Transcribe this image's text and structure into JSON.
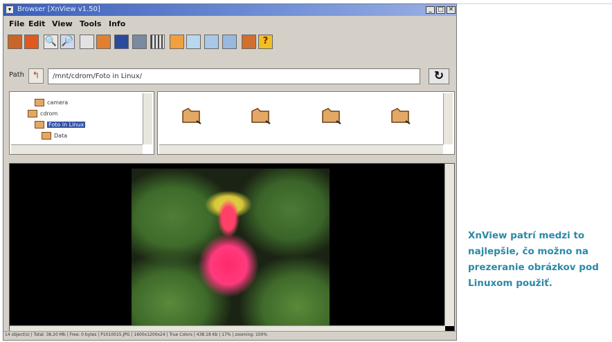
{
  "window": {
    "title": "Browser [XnView v1.50]",
    "controls": [
      "_",
      "□",
      "✕"
    ]
  },
  "menubar": {
    "items": [
      "File",
      "Edit",
      "View",
      "Tools",
      "Info"
    ]
  },
  "toolbar": {
    "icons": [
      "window-icon",
      "image-icon",
      "zoom-in-icon",
      "zoom-out-icon",
      "slideshow-icon",
      "capture-icon",
      "monitor-icon",
      "print-icon",
      "grid-icon",
      "thumbnail-icon",
      "view1-icon",
      "view2-icon",
      "view3-icon",
      "settings-icon",
      "help-icon"
    ]
  },
  "pathbar": {
    "label": "Path",
    "value": "/mnt/cdrom/Foto in Linux/",
    "refresh_glyph": "↻"
  },
  "tree": {
    "nodes": [
      "camera",
      "cdrom",
      "Foto in Linux",
      "Data"
    ]
  },
  "status": {
    "text": "14 object(s) | Total: 38.20 Mb | Free: 0 bytes | P1010015.JPG | 1600x1200x24 | True Colors | 438.18 Kb | 17% | zooming: 100%"
  },
  "caption": {
    "text": "XnView patrí medzi to najlepšie, čo možno na prezeranie obrázkov pod Linuxom použiť."
  }
}
